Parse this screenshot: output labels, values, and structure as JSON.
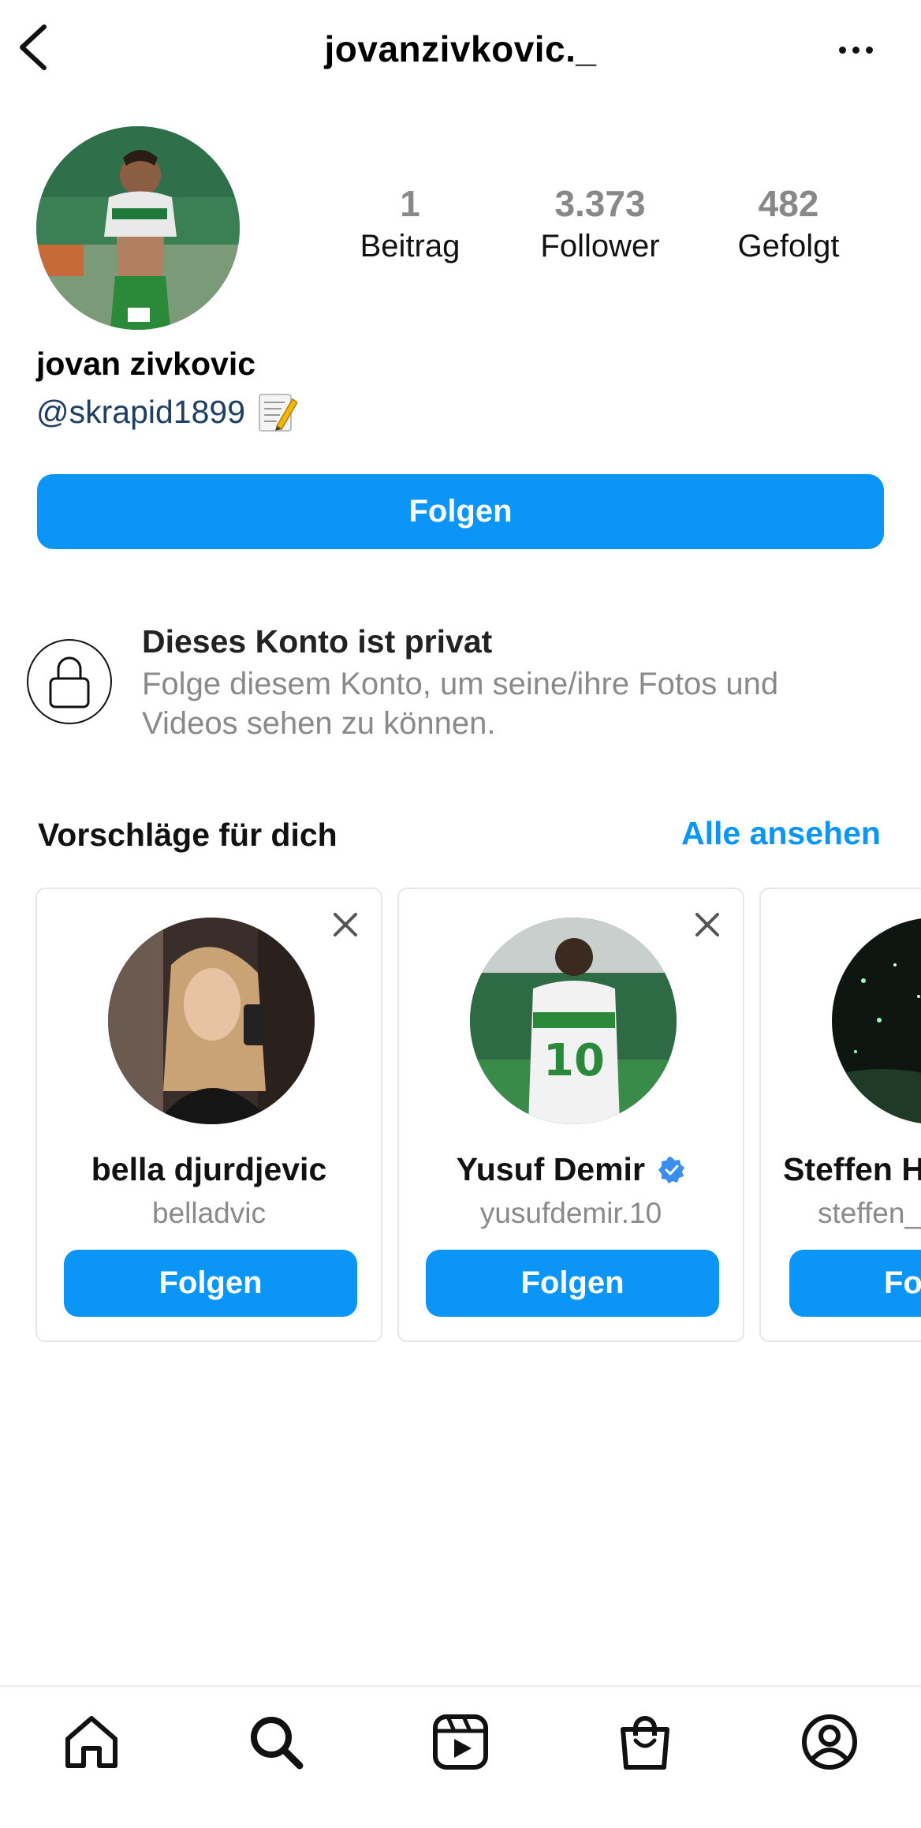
{
  "header": {
    "username": "jovanzivkovic._",
    "back_icon": "chevron-left-icon",
    "more_icon": "more-horizontal-icon"
  },
  "profile": {
    "stats": [
      {
        "value": "1",
        "label": "Beitrag"
      },
      {
        "value": "3.373",
        "label": "Follower"
      },
      {
        "value": "482",
        "label": "Gefolgt"
      }
    ],
    "display_name": "jovan zivkovic",
    "handle": "@skrapid1899",
    "handle_emoji_icon": "memo-icon",
    "follow_label": "Folgen"
  },
  "private": {
    "title": "Dieses Konto ist privat",
    "description": "Folge diesem Konto, um seine/ihre Fotos und Videos sehen zu können."
  },
  "suggestions": {
    "title": "Vorschläge für dich",
    "see_all": "Alle ansehen",
    "cards": [
      {
        "name": "bella djurdjevic",
        "username": "belladvic",
        "button": "Folgen",
        "verified": false
      },
      {
        "name": "Yusuf Demir",
        "username": "yusufdemir.10",
        "button": "Folgen",
        "verified": true
      },
      {
        "name": "Steffen H",
        "username": "steffen_",
        "button": "Fo",
        "verified": false
      }
    ]
  },
  "nav": {
    "items": [
      "home-icon",
      "search-icon",
      "reels-icon",
      "shop-icon",
      "profile-icon"
    ]
  },
  "colors": {
    "accent": "#0b95f6",
    "handle": "#1f3e62",
    "muted": "#8a8a8a"
  }
}
